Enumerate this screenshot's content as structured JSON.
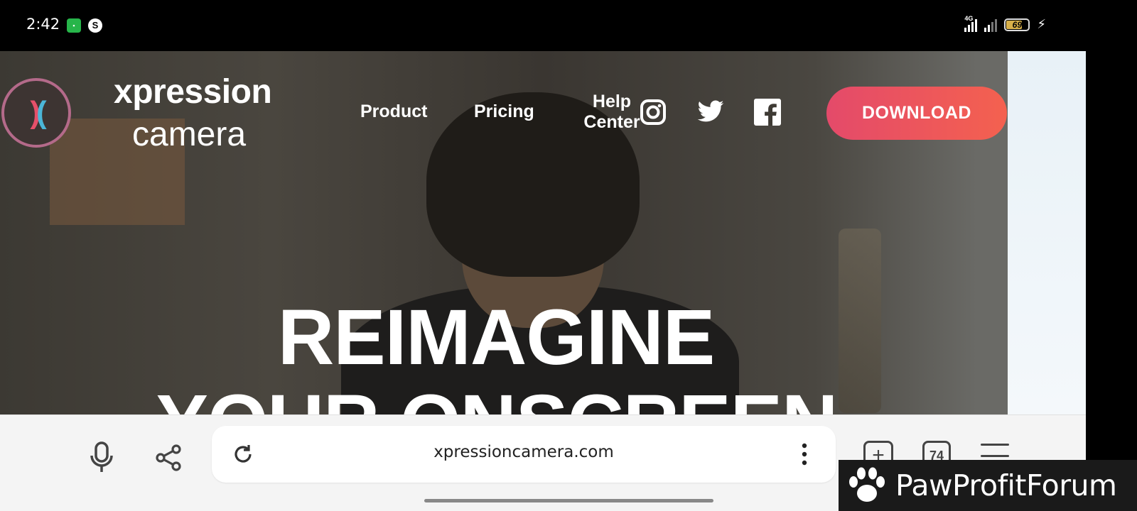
{
  "status_bar": {
    "time": "2:42",
    "network_label": "4G",
    "battery": "69"
  },
  "site": {
    "brand_top": "xpression",
    "brand_bottom": "camera",
    "nav": {
      "product": "Product",
      "pricing": "Pricing",
      "help_line1": "Help",
      "help_line2": "Center"
    },
    "social_icons": [
      "instagram-icon",
      "twitter-icon",
      "facebook-icon"
    ],
    "download_label": "DOWNLOAD",
    "hero_line1": "REIMAGINE",
    "hero_line2": "YOUR ONSCREEN"
  },
  "browser": {
    "url": "xpressioncamera.com",
    "tab_count": "74",
    "new_tab_glyph": "+"
  },
  "watermark": {
    "text": "PawProfitForum"
  },
  "colors": {
    "download_gradient_start": "#e44a6a",
    "download_gradient_end": "#f4614f",
    "logo_pink": "#e6506a",
    "logo_blue": "#4bb6d8",
    "toolbar_bg": "#f4f4f4"
  }
}
